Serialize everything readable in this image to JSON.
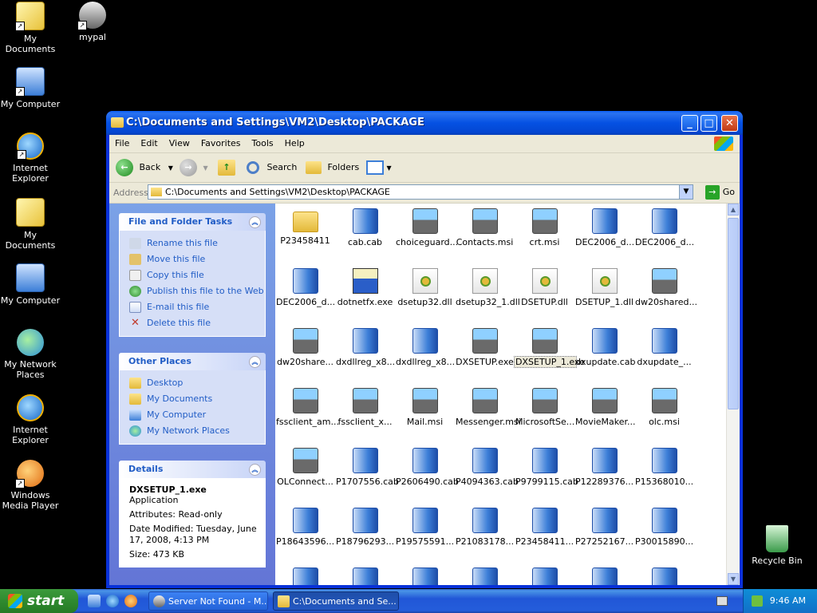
{
  "desktop": {
    "icons": [
      {
        "label": "My Documents",
        "icon": "my-documents-icon"
      },
      {
        "label": "mypal",
        "icon": "mypal-app-icon"
      },
      {
        "label": "My Computer",
        "icon": "my-computer-icon"
      },
      {
        "label": "Internet Explorer",
        "icon": "internet-explorer-icon"
      },
      {
        "label": "My Documents",
        "icon": "my-documents-icon"
      },
      {
        "label": "My Computer",
        "icon": "my-computer-icon"
      },
      {
        "label": "My Network Places",
        "icon": "network-places-icon"
      },
      {
        "label": "Internet Explorer",
        "icon": "internet-explorer-icon"
      },
      {
        "label": "Windows Media Player",
        "icon": "media-player-icon"
      },
      {
        "label": "Recycle Bin",
        "icon": "recycle-bin-icon"
      }
    ]
  },
  "window": {
    "title": "C:\\Documents and Settings\\VM2\\Desktop\\PACKAGE",
    "controls": {
      "minimize": "_",
      "maximize": "□",
      "close": "✕"
    },
    "menu": [
      "File",
      "Edit",
      "View",
      "Favorites",
      "Tools",
      "Help"
    ],
    "toolbar": {
      "back": "Back",
      "search": "Search",
      "folders": "Folders"
    },
    "address": {
      "label": "Address",
      "value": "C:\\Documents and Settings\\VM2\\Desktop\\PACKAGE",
      "go": "Go"
    }
  },
  "taskpane": {
    "file_tasks": {
      "title": "File and Folder Tasks",
      "items": [
        "Rename this file",
        "Move this file",
        "Copy this file",
        "Publish this file to the Web",
        "E-mail this file",
        "Delete this file"
      ]
    },
    "other_places": {
      "title": "Other Places",
      "items": [
        "Desktop",
        "My Documents",
        "My Computer",
        "My Network Places"
      ]
    },
    "details": {
      "title": "Details",
      "name": "DXSETUP_1.exe",
      "type": "Application",
      "attributes": "Attributes: Read-only",
      "modified": "Date Modified: Tuesday, June 17, 2008, 4:13 PM",
      "size": "Size: 473 KB"
    }
  },
  "files": [
    {
      "name": "P23458411",
      "kind": "folder"
    },
    {
      "name": "cab.cab",
      "kind": "cab"
    },
    {
      "name": "choiceguard...",
      "kind": "msi"
    },
    {
      "name": "Contacts.msi",
      "kind": "msi"
    },
    {
      "name": "crt.msi",
      "kind": "msi"
    },
    {
      "name": "DEC2006_d...",
      "kind": "cab"
    },
    {
      "name": "DEC2006_d...",
      "kind": "cab"
    },
    {
      "name": "DEC2006_d...",
      "kind": "cab"
    },
    {
      "name": "dotnetfx.exe",
      "kind": "exe"
    },
    {
      "name": "dsetup32.dll",
      "kind": "dll"
    },
    {
      "name": "dsetup32_1.dll",
      "kind": "dll"
    },
    {
      "name": "DSETUP.dll",
      "kind": "dll"
    },
    {
      "name": "DSETUP_1.dll",
      "kind": "dll"
    },
    {
      "name": "dw20shared...",
      "kind": "msi"
    },
    {
      "name": "dw20share...",
      "kind": "msi"
    },
    {
      "name": "dxdllreg_x8...",
      "kind": "cab"
    },
    {
      "name": "dxdllreg_x8...",
      "kind": "cab"
    },
    {
      "name": "DXSETUP.exe",
      "kind": "msi"
    },
    {
      "name": "DXSETUP_1.exe",
      "kind": "msi",
      "selected": true
    },
    {
      "name": "dxupdate.cab",
      "kind": "cab"
    },
    {
      "name": "dxupdate_...",
      "kind": "cab"
    },
    {
      "name": "fssclient_am...",
      "kind": "msi"
    },
    {
      "name": "fssclient_x...",
      "kind": "msi"
    },
    {
      "name": "Mail.msi",
      "kind": "msi"
    },
    {
      "name": "Messenger.msi",
      "kind": "msi"
    },
    {
      "name": "MicrosoftSe...",
      "kind": "msi"
    },
    {
      "name": "MovieMaker...",
      "kind": "msi"
    },
    {
      "name": "olc.msi",
      "kind": "msi"
    },
    {
      "name": "OLConnect...",
      "kind": "msi"
    },
    {
      "name": "P1707556.cab",
      "kind": "cab"
    },
    {
      "name": "P2606490.cab",
      "kind": "cab"
    },
    {
      "name": "P4094363.cab",
      "kind": "cab"
    },
    {
      "name": "P9799115.cab",
      "kind": "cab"
    },
    {
      "name": "P12289376...",
      "kind": "cab"
    },
    {
      "name": "P15368010...",
      "kind": "cab"
    },
    {
      "name": "P18643596...",
      "kind": "cab"
    },
    {
      "name": "P18796293...",
      "kind": "cab"
    },
    {
      "name": "P19575591...",
      "kind": "cab"
    },
    {
      "name": "P21083178...",
      "kind": "cab"
    },
    {
      "name": "P23458411...",
      "kind": "cab"
    },
    {
      "name": "P27252167...",
      "kind": "cab"
    },
    {
      "name": "P30015890...",
      "kind": "cab"
    },
    {
      "name": "",
      "kind": "cab"
    },
    {
      "name": "",
      "kind": "cab"
    },
    {
      "name": "",
      "kind": "cab"
    },
    {
      "name": "",
      "kind": "cab"
    },
    {
      "name": "",
      "kind": "cab"
    },
    {
      "name": "",
      "kind": "cab"
    },
    {
      "name": "",
      "kind": "cab"
    }
  ],
  "taskbar": {
    "start": "start",
    "tasks": [
      {
        "label": "Server Not Found - M...",
        "active": false
      },
      {
        "label": "C:\\Documents and Se...",
        "active": true
      }
    ],
    "clock": "9:46 AM"
  }
}
